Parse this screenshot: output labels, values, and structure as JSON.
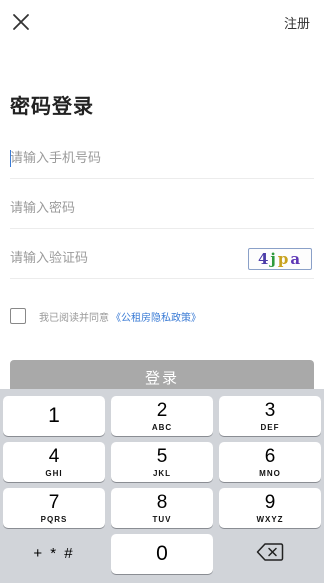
{
  "header": {
    "register_label": "注册"
  },
  "title": "密码登录",
  "form": {
    "phone_placeholder": "请输入手机号码",
    "password_placeholder": "请输入密码",
    "code_placeholder": "请输入验证码",
    "captcha_text": [
      "4",
      "j",
      "p",
      "a"
    ]
  },
  "agreement": {
    "text": "我已阅读并同意",
    "policy_link": "《公租房隐私政策》"
  },
  "login_label": "登录",
  "keypad": {
    "rows": [
      [
        {
          "num": "1",
          "sub": ""
        },
        {
          "num": "2",
          "sub": "ABC"
        },
        {
          "num": "3",
          "sub": "DEF"
        }
      ],
      [
        {
          "num": "4",
          "sub": "GHI"
        },
        {
          "num": "5",
          "sub": "JKL"
        },
        {
          "num": "6",
          "sub": "MNO"
        }
      ],
      [
        {
          "num": "7",
          "sub": "PQRS"
        },
        {
          "num": "8",
          "sub": "TUV"
        },
        {
          "num": "9",
          "sub": "WXYZ"
        }
      ]
    ],
    "symbols_label": "+ * #",
    "zero": "0"
  },
  "colors": {
    "accent": "#3a7bd5",
    "button_disabled": "#a9a9a9",
    "keypad_bg": "#d1d4d9"
  }
}
